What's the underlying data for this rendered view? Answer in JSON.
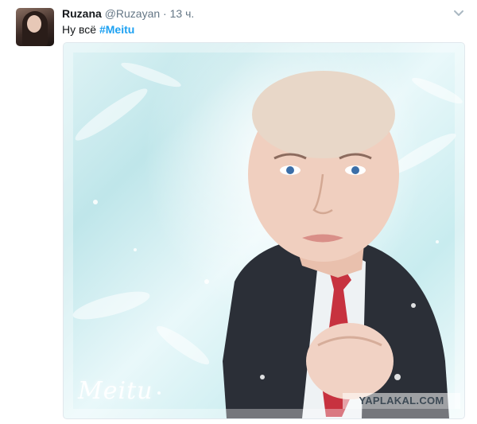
{
  "tweet": {
    "author_name": "Ruzana",
    "author_handle": "@Ruzayan",
    "separator": "·",
    "time": "13 ч.",
    "text": "Ну всё",
    "hashtag": "#Meitu"
  },
  "media": {
    "app_watermark": "Meitu",
    "site_watermark": "YAPLAKAL.COM"
  },
  "icons": {
    "more": "chevron-down-icon"
  }
}
